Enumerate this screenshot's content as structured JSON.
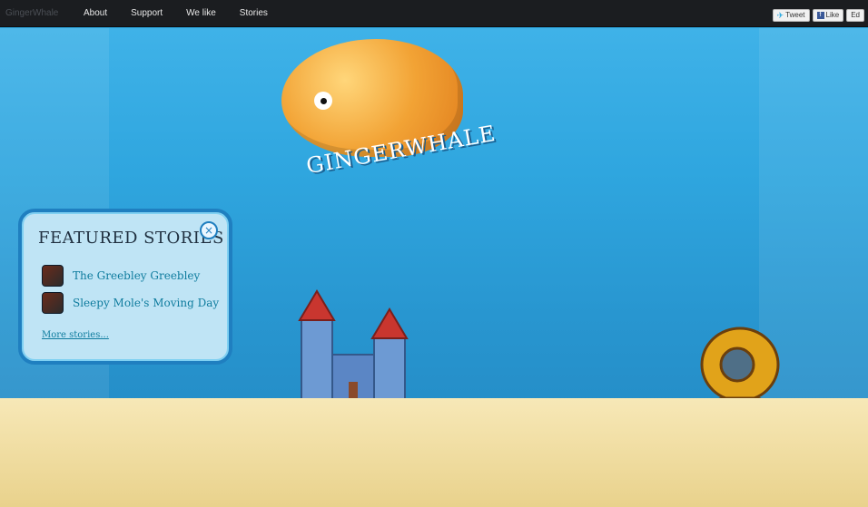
{
  "topbar": {
    "brand": "GingerWhale",
    "nav": [
      {
        "label": "About"
      },
      {
        "label": "Support"
      },
      {
        "label": "We like"
      },
      {
        "label": "Stories"
      }
    ],
    "social": [
      {
        "label": "Tweet"
      },
      {
        "label": "Like"
      },
      {
        "label": "Ed"
      }
    ]
  },
  "hero": {
    "logo_text": "GINGERWHALE"
  },
  "featured": {
    "title": "FEATURED STORIES",
    "close_icon": "close-icon",
    "stories": [
      {
        "title": "The Greebley Greebley",
        "thumb": "story-thumb-icon"
      },
      {
        "title": "Sleepy Mole's Moving Day",
        "thumb": "story-thumb-icon"
      }
    ],
    "more_link": "More stories..."
  },
  "colors": {
    "topbar": "#1b1d20",
    "water": "#2a9fd6",
    "sand": "#f7e8b7",
    "panel": "#bfe4f5",
    "panel_border": "#1f7fc0"
  }
}
